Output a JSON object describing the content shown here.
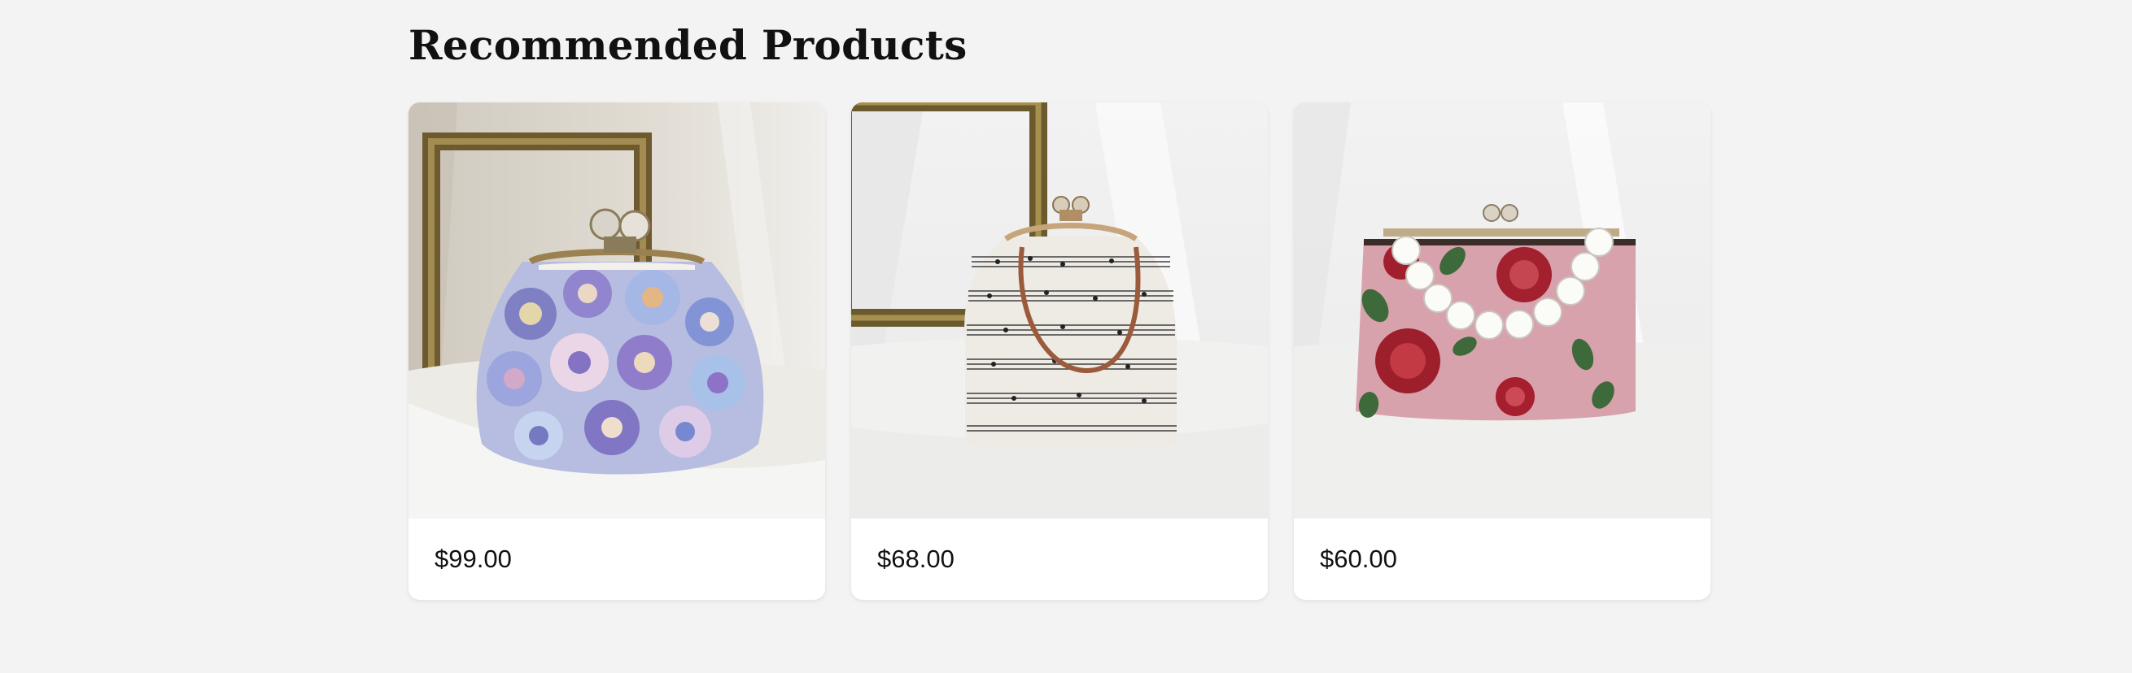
{
  "section": {
    "title": "Recommended Products"
  },
  "products": [
    {
      "price": "$99.00",
      "image": "purse-floral-tulle-icon"
    },
    {
      "price": "$68.00",
      "image": "purse-sheet-music-icon"
    },
    {
      "price": "$60.00",
      "image": "purse-rose-pearl-handle-icon"
    }
  ]
}
